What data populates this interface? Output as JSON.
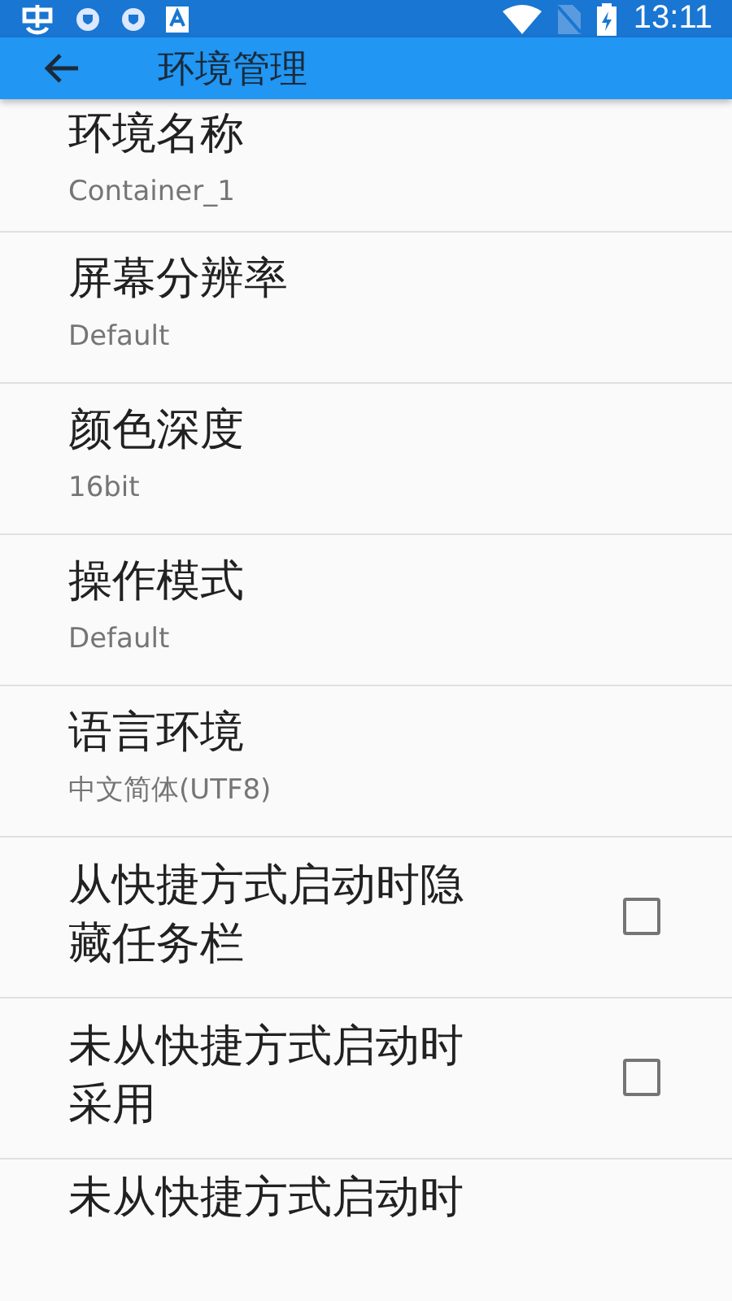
{
  "status_bar": {
    "time": "13:11"
  },
  "app_bar": {
    "title": "环境管理"
  },
  "settings": [
    {
      "kind": "value",
      "title": "环境名称",
      "value": "Container_1"
    },
    {
      "kind": "value",
      "title": "屏幕分辨率",
      "value": "Default"
    },
    {
      "kind": "value",
      "title": "颜色深度",
      "value": "16bit"
    },
    {
      "kind": "value",
      "title": "操作模式",
      "value": "Default"
    },
    {
      "kind": "value",
      "title": "语言环境",
      "value": "中文简体(UTF8)"
    },
    {
      "kind": "checkbox",
      "lines": [
        "从快捷方式启动时隐",
        "藏任务栏"
      ],
      "checked": false
    },
    {
      "kind": "checkbox",
      "lines": [
        "未从快捷方式启动时",
        "采用"
      ],
      "checked": false
    },
    {
      "kind": "partial",
      "title": "未从快捷方式启动时"
    }
  ]
}
